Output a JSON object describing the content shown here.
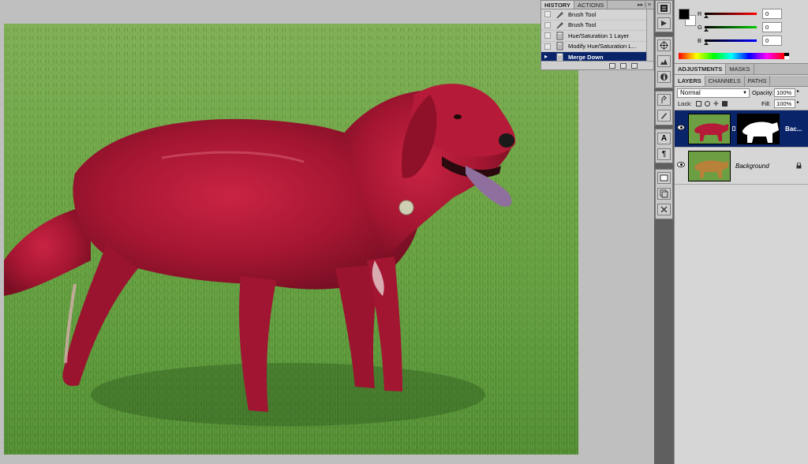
{
  "history": {
    "tabs": [
      "HISTORY",
      "ACTIONS"
    ],
    "items": [
      {
        "label": "Brush Tool",
        "icon": "brush-icon"
      },
      {
        "label": "Brush Tool",
        "icon": "brush-icon"
      },
      {
        "label": "Hue/Saturation 1 Layer",
        "icon": "layer-doc-icon"
      },
      {
        "label": "Modify Hue/Saturation L...",
        "icon": "layer-doc-icon"
      },
      {
        "label": "Merge Down",
        "icon": "layer-doc-icon",
        "selected": true
      }
    ]
  },
  "color_panel": {
    "foreground": "#000000",
    "background": "#ffffff",
    "channels": [
      {
        "label": "R",
        "value": "0",
        "color": "#ff0000"
      },
      {
        "label": "G",
        "value": "0",
        "color": "#00c000"
      },
      {
        "label": "B",
        "value": "0",
        "color": "#0000ff"
      }
    ]
  },
  "adjustments": {
    "tabs": [
      "ADJUSTMENTS",
      "MASKS"
    ]
  },
  "layers": {
    "tabs": [
      "LAYERS",
      "CHANNELS",
      "PATHS"
    ],
    "blend_mode": "Normal",
    "opacity_label": "Opacity:",
    "opacity": "100%",
    "lock_label": "Lock:",
    "fill_label": "Fill:",
    "fill": "100%",
    "items": [
      {
        "name": "Bac...",
        "selected": true,
        "has_mask": true
      },
      {
        "name": "Background",
        "selected": false,
        "locked": true
      }
    ]
  }
}
